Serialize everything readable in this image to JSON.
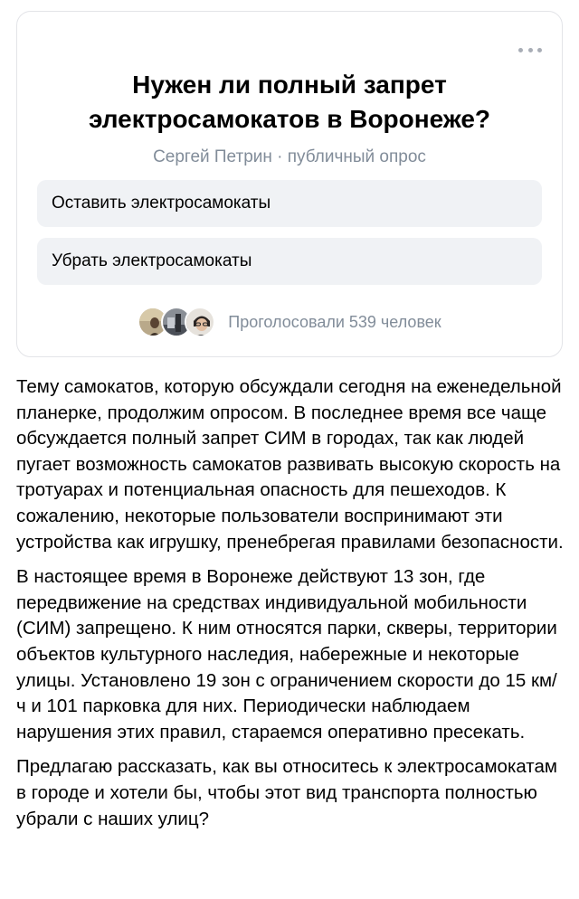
{
  "poll": {
    "title": "Нужен ли полный запрет электросамокатов в Воронеже?",
    "meta": "Сергей Петрин · публичный опрос",
    "options": [
      {
        "label": "Оставить электросамокаты"
      },
      {
        "label": "Убрать электросамокаты"
      }
    ],
    "voters_text": "Проголосовали 539 человек",
    "more_icon": "more-horizontal-icon"
  },
  "post": {
    "paragraphs": [
      "Тему самокатов, которую обсуждали сегодня на еженедельной планерке, продолжим опросом. В последнее время все чаще обсуждается полный запрет СИМ в городах, так как людей пугает возможность самокатов развивать высокую скорость на тротуарах и потенциальная опасность для пешеходов. К сожалению, некоторые пользователи воспринимают эти устройства как игрушку, пренебрегая правилами безопасности.",
      "В настоящее время в Воронеже действуют 13 зон, где передвижение на средствах индивидуальной мобильности (СИМ) запрещено. К ним относятся парки, скверы, территории объектов культурного наследия, набережные и некоторые улицы. Установлено 19 зон с ограничением скорости до 15 км/ч и 101 парковка для них. Периодически наблюдаем нарушения этих правил, стараемся оперативно пресекать.",
      "Предлагаю рассказать, как вы относитесь к электросамокатам в городе и хотели бы, чтобы этот вид транспорта полностью убрали с наших улиц?"
    ]
  },
  "colors": {
    "card_border": "#e3e4e8",
    "option_bg": "#f0f2f5",
    "secondary_text": "#818c99"
  }
}
